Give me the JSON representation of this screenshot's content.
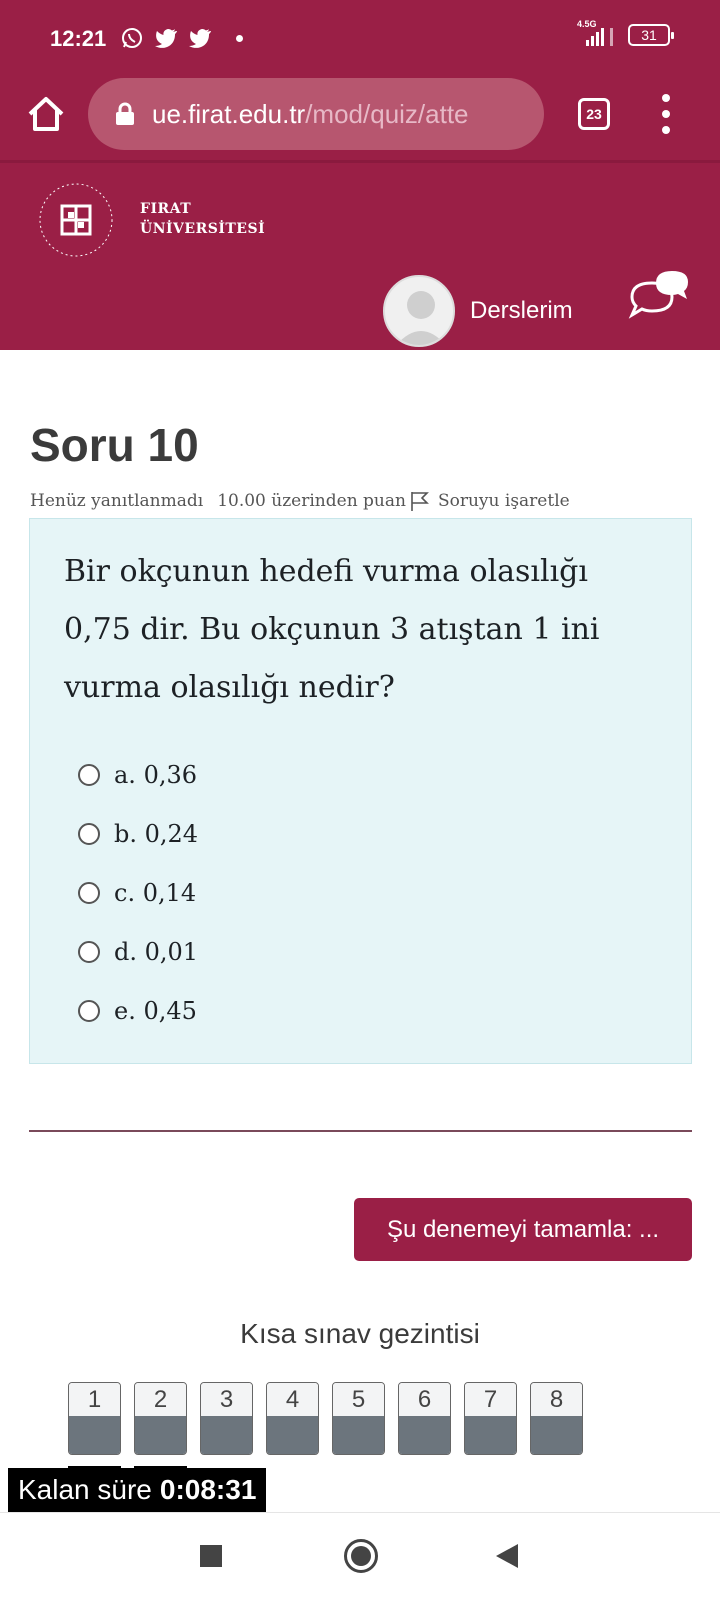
{
  "status_bar": {
    "time": "12:21",
    "network": "4.5G",
    "battery": "31"
  },
  "browser": {
    "url_host": "ue.firat.edu.tr",
    "url_path": "/mod/quiz/atte",
    "tab_count": "23"
  },
  "site": {
    "logo_line1": "FIRAT",
    "logo_line2": "ÜNİVERSİTESİ",
    "seal_text": "FIRAT ÜNİVERSİTESİ 1975",
    "courses_label": "Derslerim"
  },
  "question": {
    "number_title": "Soru 10",
    "status": "Henüz yanıtlanmadı",
    "points": "10.00 üzerinden puan",
    "flag_label": "Soruyu işaretle",
    "text": "Bir okçunun hedefi vurma olasılığı 0,75 dir. Bu okçunun 3 atıştan 1 ini vurma olasılığı nedir?",
    "options": [
      {
        "label": "a. 0,36"
      },
      {
        "label": "b. 0,24"
      },
      {
        "label": "c. 0,14"
      },
      {
        "label": "d. 0,01"
      },
      {
        "label": "e. 0,45"
      }
    ]
  },
  "finish_button": "Şu denemeyi tamamla: ...",
  "quiz_nav": {
    "title": "Kısa sınav gezintisi",
    "buttons": [
      "1",
      "2",
      "3",
      "4",
      "5",
      "6",
      "7",
      "8"
    ]
  },
  "timer": {
    "label": "Kalan süre",
    "value": "0:08:31"
  },
  "colors": {
    "brand": "#9a1f46",
    "question_bg": "#e6f5f7",
    "nav_fill": "#6c757d"
  }
}
